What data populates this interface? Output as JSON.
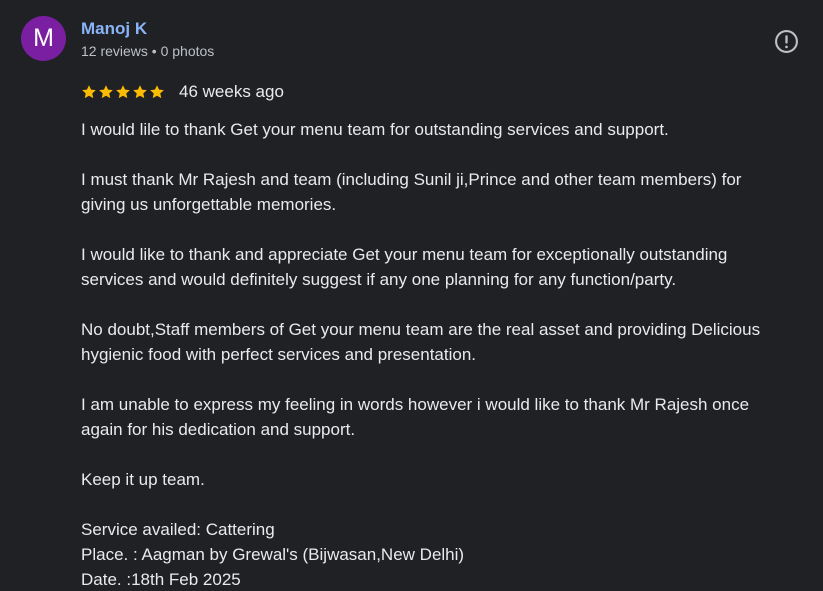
{
  "author": {
    "initial": "M",
    "avatar_color": "#7b1fa2",
    "name": "Manoj K",
    "meta": "12 reviews • 0 photos"
  },
  "rating": {
    "stars": 5,
    "max_stars": 5,
    "star_color": "#fbbc04"
  },
  "date": "46 weeks ago",
  "icons": {
    "report": "exclamation-circle-icon",
    "star": "star-icon"
  },
  "body": {
    "p1": "I would lile to thank Get your menu team for outstanding services and support.",
    "p2_line1": "I must thank Mr Rajesh and team (including Sunil ji,Prince and other team members) for",
    "p2_line2": "giving us unforgettable memories.",
    "p3_line1": "I would like to thank and appreciate Get your menu team for exceptionally outstanding",
    "p3_line2": "services and would definitely suggest if any one planning for any function/party.",
    "p4_line1": "No doubt,Staff members of Get your menu team are the real asset and providing Delicious",
    "p4_line2": "hygienic food with perfect services and presentation.",
    "p5_line1": "I am unable to express my feeling in words however i would like to thank Mr Rajesh once",
    "p5_line2": "again for his dedication and support.",
    "p6": "Keep it up team.",
    "service": "Service availed: Cattering",
    "place": "Place. : Aagman by Grewal's (Bijwasan,New Delhi)",
    "date_line": "Date. :18th Feb 2025"
  }
}
